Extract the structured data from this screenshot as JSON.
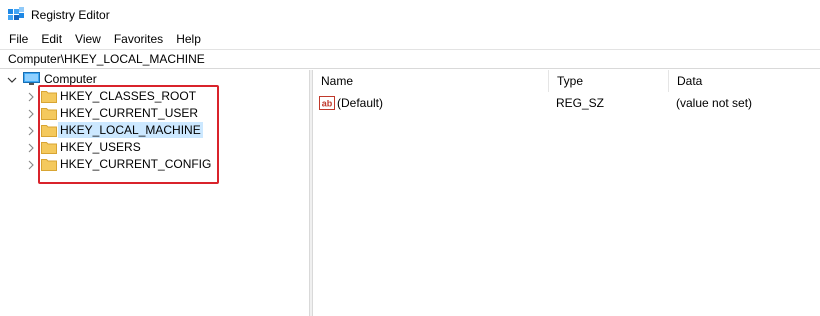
{
  "window": {
    "title": "Registry Editor"
  },
  "menu": [
    "File",
    "Edit",
    "View",
    "Favorites",
    "Help"
  ],
  "address": "Computer\\HKEY_LOCAL_MACHINE",
  "tree": {
    "root": "Computer",
    "keys": [
      {
        "label": "HKEY_CLASSES_ROOT",
        "selected": false
      },
      {
        "label": "HKEY_CURRENT_USER",
        "selected": false
      },
      {
        "label": "HKEY_LOCAL_MACHINE",
        "selected": true
      },
      {
        "label": "HKEY_USERS",
        "selected": false
      },
      {
        "label": "HKEY_CURRENT_CONFIG",
        "selected": false
      }
    ]
  },
  "list": {
    "columns": [
      "Name",
      "Type",
      "Data"
    ],
    "rows": [
      {
        "name": "(Default)",
        "type": "REG_SZ",
        "data": "(value not set)",
        "icon": "string-value-icon"
      }
    ]
  },
  "colors": {
    "selection": "#cce8ff",
    "highlight_border": "#d9232b",
    "folder": "#f4c95d"
  }
}
